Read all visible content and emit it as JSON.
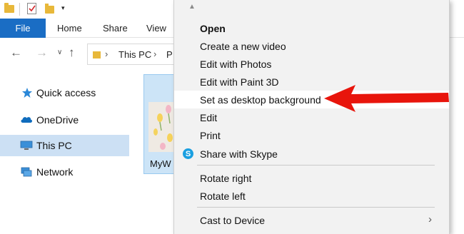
{
  "ribbon": {
    "file_tab": "File",
    "home_tab": "Home",
    "share_tab": "Share",
    "view_tab": "View"
  },
  "quick_access_toolbar": {
    "icons": [
      "folder-icon",
      "properties-icon",
      "new-folder-icon",
      "customize-dropdown-icon"
    ]
  },
  "address": {
    "crumb1": "This PC",
    "crumb2_truncated": "P"
  },
  "navpane": {
    "items": [
      {
        "label": "Quick access",
        "icon": "star-icon"
      },
      {
        "label": "OneDrive",
        "icon": "cloud-icon"
      },
      {
        "label": "This PC",
        "icon": "computer-icon",
        "selected": true
      },
      {
        "label": "Network",
        "icon": "network-icon"
      }
    ]
  },
  "content": {
    "file_name": "MyW"
  },
  "context_menu": {
    "items": [
      {
        "label": "Open",
        "bold": true
      },
      {
        "label": "Create a new video"
      },
      {
        "label": "Edit with Photos"
      },
      {
        "label": "Edit with Paint 3D"
      },
      {
        "label": "Set as desktop background",
        "highlighted": true
      },
      {
        "label": "Edit"
      },
      {
        "label": "Print"
      },
      {
        "label": "Share with Skype",
        "icon": "skype-icon"
      },
      {
        "label": "Rotate right"
      },
      {
        "label": "Rotate left"
      },
      {
        "label": "Cast to Device",
        "submenu": true
      }
    ]
  },
  "colors": {
    "file_tab": "#1a6dc4",
    "selection": "#cce0f4",
    "menu_bg": "#f2f2f2",
    "annotation_arrow": "#e8150c",
    "skype": "#1a9fe0",
    "folder": "#e8b83a"
  }
}
